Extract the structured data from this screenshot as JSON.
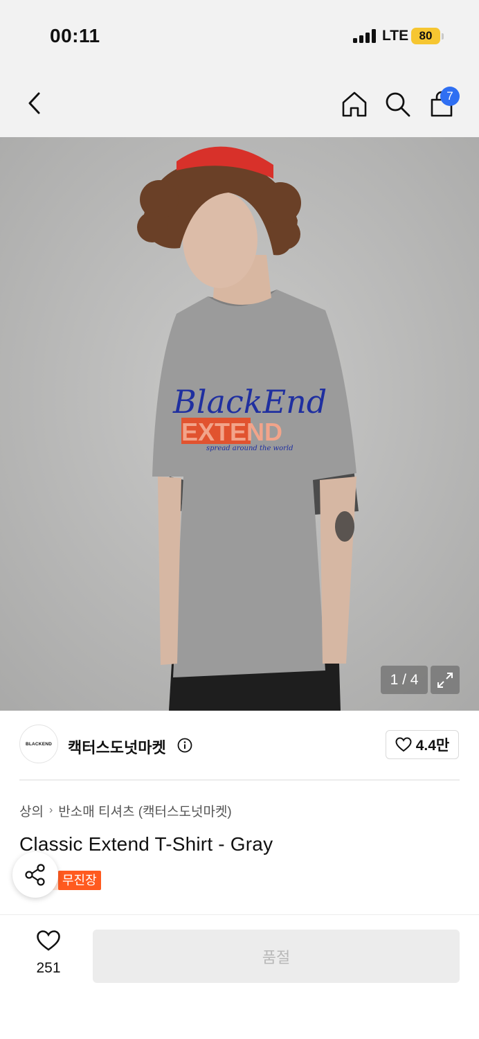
{
  "status_bar": {
    "time": "00:11",
    "network": "LTE",
    "battery": "80",
    "battery_color": "#f6c631"
  },
  "nav": {
    "back_icon": "chevron-left-icon",
    "home_icon": "home-icon",
    "search_icon": "search-icon",
    "cart_icon": "shopping-bag-icon",
    "cart_badge": "7",
    "badge_color": "#2f6ff2"
  },
  "gallery": {
    "counter": "1 / 4",
    "expand_icon": "expand-icon"
  },
  "brand": {
    "logo_text": "BLACKEND",
    "name": "캑터스도넛마켓",
    "info_icon": "info-icon",
    "like_icon": "heart-icon",
    "like_count": "4.4만"
  },
  "product": {
    "breadcrumb": [
      "상의",
      "반소매 티셔츠 (캑터스도넛마켓)"
    ],
    "title": "Classic Extend T-Shirt - Gray",
    "badge": "무진장",
    "badge_color": "#ff5a1f",
    "share_icon": "share-icon"
  },
  "bottom_bar": {
    "wish_icon": "heart-outline-icon",
    "wish_count": "251",
    "soldout_label": "품절"
  }
}
